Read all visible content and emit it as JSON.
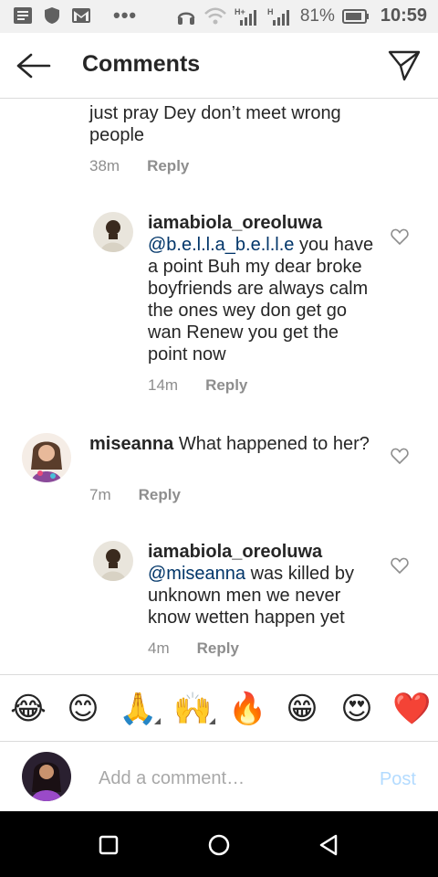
{
  "status_bar": {
    "battery_pct": "81%",
    "time": "10:59",
    "signal_1": "H+",
    "signal_2": "H",
    "dots": "•••"
  },
  "header": {
    "title": "Comments"
  },
  "comments": [
    {
      "text": "just pray Dey don’t meet  wrong people",
      "time": "38m",
      "reply": "Reply"
    },
    {
      "username": "iamabiola_oreoluwa",
      "mention": "@b.e.l.l.a_b.e.l.l.e",
      "text": " you have a point Buh my dear broke boyfriends are always calm the ones wey don get go wan Renew you get the point now",
      "time": "14m",
      "reply": "Reply"
    },
    {
      "username": "miseanna",
      "text": " What happened to her?",
      "time": "7m",
      "reply": "Reply"
    },
    {
      "username": "iamabiola_oreoluwa",
      "mention": "@miseanna",
      "text": " was killed by unknown men we never know wetten happen yet",
      "time": "4m",
      "reply": "Reply"
    }
  ],
  "emoji_bar": [
    "😂",
    "😊",
    "🙏",
    "🙌",
    "🔥",
    "😁",
    "😍",
    "❤️"
  ],
  "add_comment": {
    "placeholder": "Add a comment…",
    "post": "Post"
  },
  "colors": {
    "mention": "#003569",
    "post_disabled": "#b3dbff",
    "meta": "#8e8e8e"
  }
}
